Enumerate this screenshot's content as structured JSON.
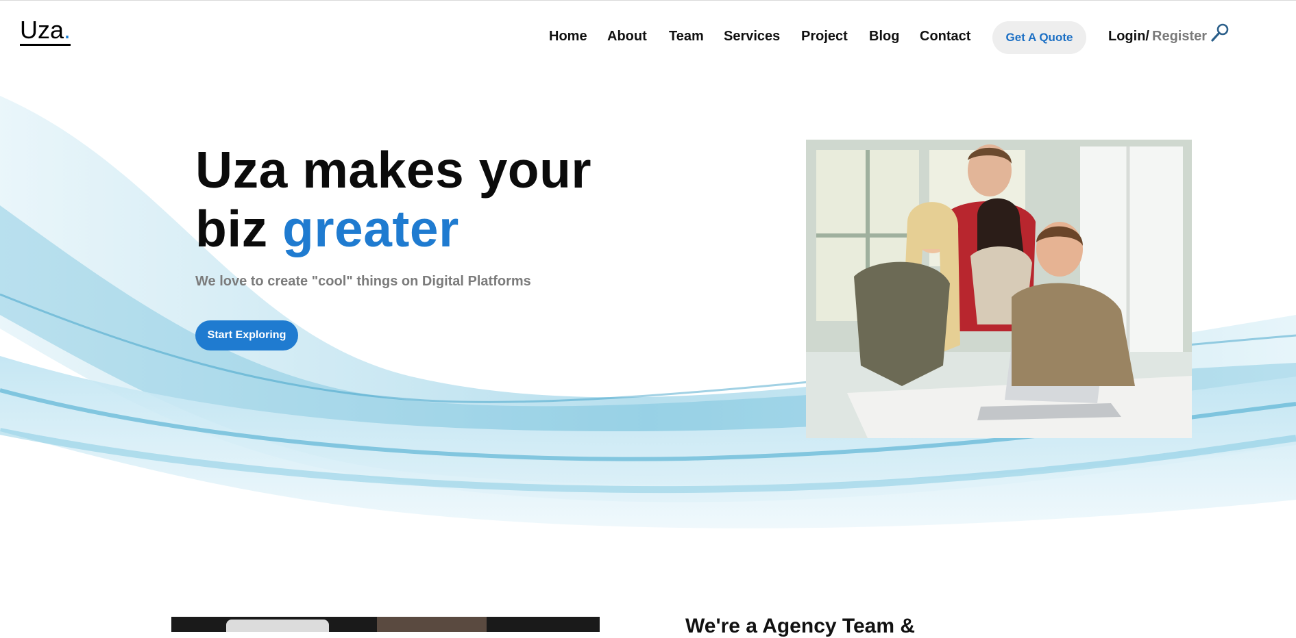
{
  "header": {
    "logo": {
      "text": "Uza",
      "dot": "."
    },
    "nav": [
      "Home",
      "About",
      "Team",
      "Services",
      "Project",
      "Blog",
      "Contact"
    ],
    "quote_button": "Get A Quote",
    "login": "Login/",
    "register": "Register",
    "search_icon": "search-icon"
  },
  "hero": {
    "title_line1": "Uza makes your",
    "title_line2_prefix": "biz ",
    "title_accent": "greater",
    "subtitle": "We love to create \"cool\" things on Digital Platforms",
    "cta": "Start Exploring"
  },
  "about": {
    "heading": "We're a Agency Team &"
  },
  "colors": {
    "accent": "#1f7bd0",
    "nav_text": "#111111",
    "muted_text": "#7b7b7b",
    "quote_bg": "#eeeeee",
    "wave": "#3ea6cc"
  }
}
